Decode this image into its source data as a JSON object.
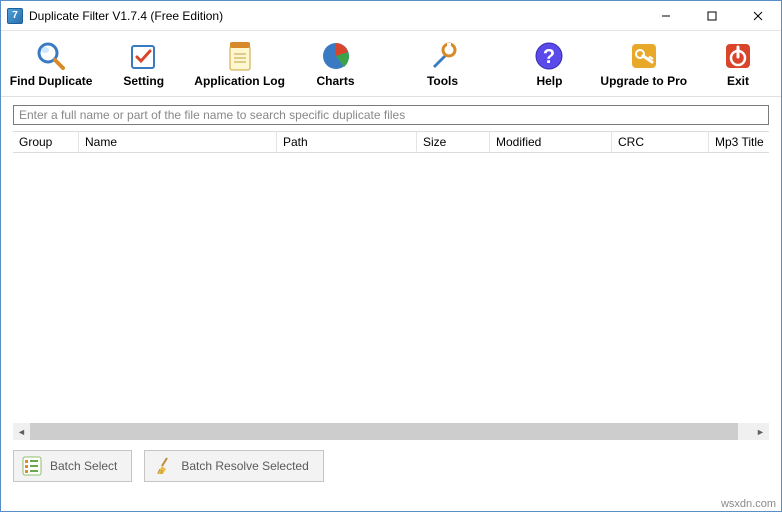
{
  "titlebar": {
    "title": "Duplicate Filter  V1.7.4 (Free Edition)"
  },
  "toolbar": {
    "find_duplicate": "Find Duplicate",
    "setting": "Setting",
    "application_log": "Application Log",
    "charts": "Charts",
    "tools": "Tools",
    "help": "Help",
    "upgrade": "Upgrade to Pro",
    "exit": "Exit"
  },
  "search": {
    "placeholder": "Enter a full name or part of the file name to search specific duplicate files"
  },
  "columns": {
    "group": "Group",
    "name": "Name",
    "path": "Path",
    "size": "Size",
    "modified": "Modified",
    "crc": "CRC",
    "mp3title": "Mp3 Title"
  },
  "rows": [],
  "bottom": {
    "batch_select": "Batch Select",
    "batch_resolve": "Batch Resolve Selected"
  },
  "watermark": "wsxdn.com"
}
